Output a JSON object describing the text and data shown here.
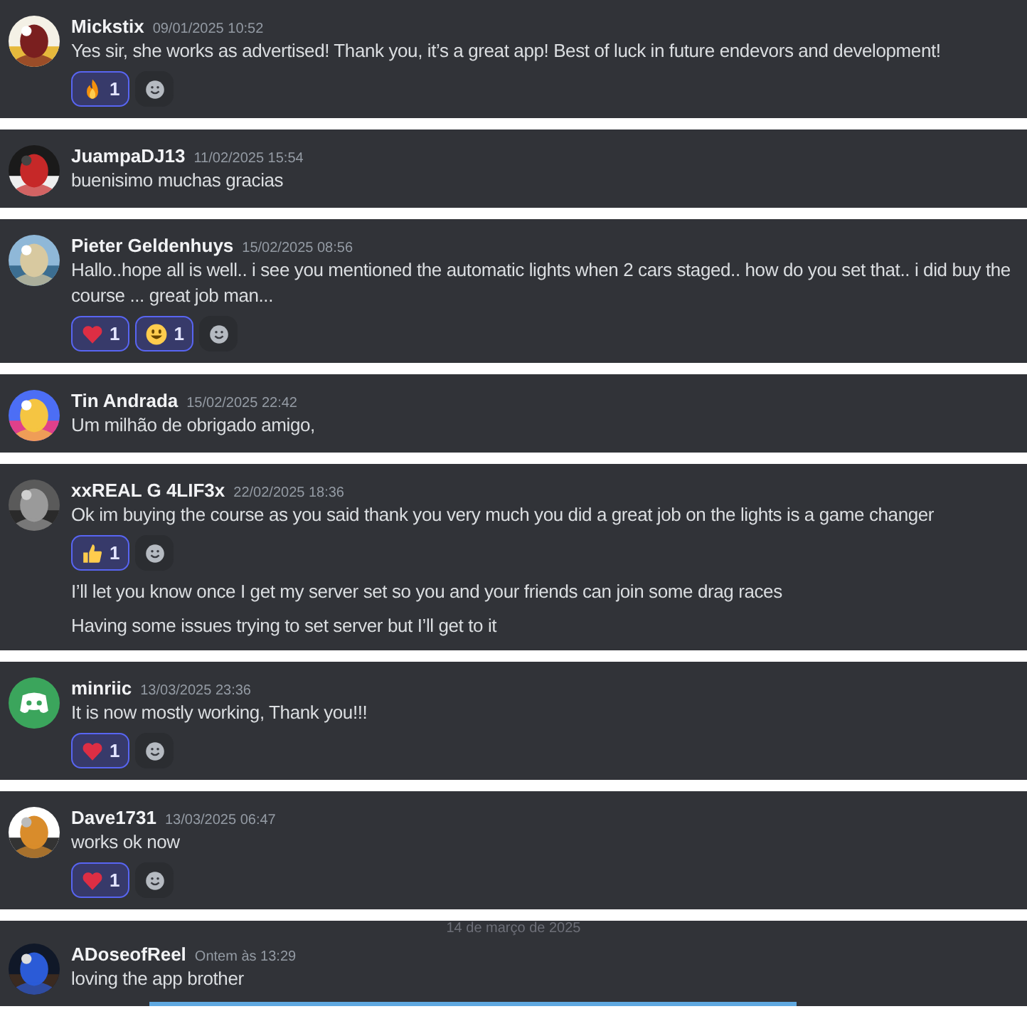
{
  "messages": [
    {
      "author": "Mickstix",
      "time": "09/01/2025 10:52",
      "avatar": {
        "kind": "picture"
      },
      "parts": [
        {
          "kind": "text",
          "text": "Yes sir, she works as advertised! Thank you, it’s a great app! Best of luck in future endevors and development!"
        },
        {
          "kind": "reactions",
          "reactions": [
            {
              "kind": "fire",
              "count": "1",
              "selected": true
            }
          ]
        }
      ]
    },
    {
      "author": "JuampaDJ13",
      "time": "11/02/2025 15:54",
      "avatar": {
        "kind": "picture"
      },
      "parts": [
        {
          "kind": "text",
          "text": "buenisimo muchas gracias"
        }
      ]
    },
    {
      "author": "Pieter Geldenhuys",
      "time": "15/02/2025 08:56",
      "avatar": {
        "kind": "picture"
      },
      "parts": [
        {
          "kind": "text",
          "text": "Hallo..hope all is well.. i see you mentioned the automatic  lights when 2 cars staged.. how do you set that.. i did buy the course ... great job man..."
        },
        {
          "kind": "reactions",
          "reactions": [
            {
              "kind": "heart",
              "count": "1",
              "selected": true
            },
            {
              "kind": "smile",
              "count": "1",
              "selected": true
            }
          ]
        }
      ]
    },
    {
      "author": "Tin Andrada",
      "time": "15/02/2025 22:42",
      "avatar": {
        "kind": "picture"
      },
      "parts": [
        {
          "kind": "text",
          "text": "Um milhão de obrigado amigo,"
        }
      ]
    },
    {
      "author": "xxREAL G 4LIF3x",
      "time": "22/02/2025 18:36",
      "avatar": {
        "kind": "picture"
      },
      "parts": [
        {
          "kind": "text",
          "text": "Ok im buying the course as you said thank you very much you did a great job on the lights is a game changer"
        },
        {
          "kind": "reactions",
          "reactions": [
            {
              "kind": "thumbsup",
              "count": "1",
              "selected": true
            }
          ]
        },
        {
          "kind": "text",
          "text": "I’ll let you know once I get my server set so you and your friends can join some drag races"
        },
        {
          "kind": "text",
          "text": "Having some issues trying to set server but I’ll get to it"
        }
      ]
    },
    {
      "author": "minriic",
      "time": "13/03/2025 23:36",
      "avatar": {
        "kind": "default"
      },
      "parts": [
        {
          "kind": "text",
          "text": "It is now mostly working, Thank you!!!"
        },
        {
          "kind": "reactions",
          "reactions": [
            {
              "kind": "heart",
              "count": "1",
              "selected": true
            }
          ]
        }
      ]
    },
    {
      "author": "Dave1731",
      "time": "13/03/2025 06:47",
      "avatar": {
        "kind": "picture"
      },
      "parts": [
        {
          "kind": "text",
          "text": "works ok now"
        },
        {
          "kind": "reactions",
          "reactions": [
            {
              "kind": "heart",
              "count": "1",
              "selected": true
            }
          ]
        }
      ]
    },
    {
      "divider": "14 de março de 2025",
      "author": "ADoseofReel",
      "time": "Ontem às 13:29",
      "avatar": {
        "kind": "picture"
      },
      "parts": [
        {
          "kind": "text",
          "text": "loving the app brother"
        }
      ]
    }
  ]
}
